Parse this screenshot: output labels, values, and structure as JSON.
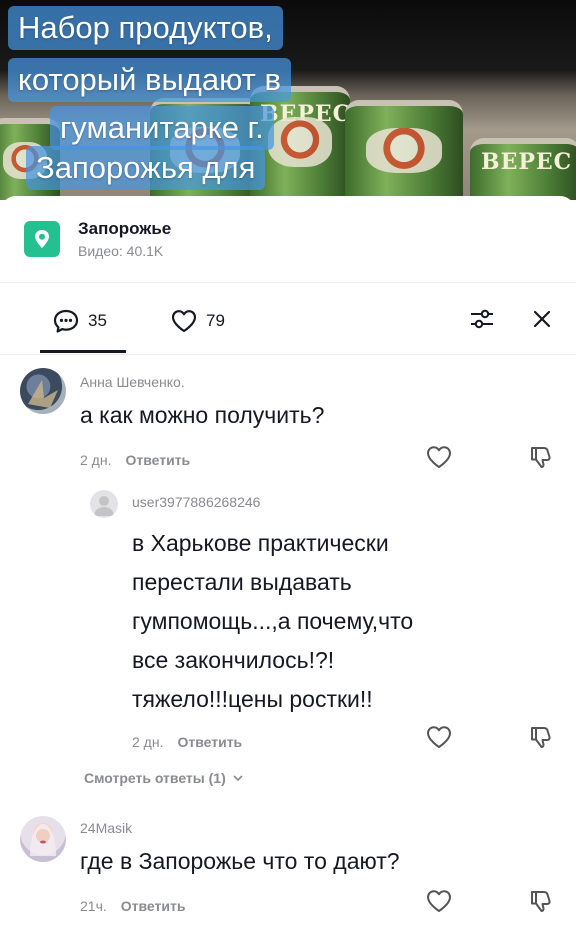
{
  "video": {
    "overlay_lines": [
      "Набор продуктов,",
      "который выдают в",
      "гуманитарке г.",
      "Запорожья для"
    ],
    "can_brand": "ВЕРЕС"
  },
  "location": {
    "name": "Запорожье",
    "views": "Видео: 40.1K",
    "icon": "location-pin-icon",
    "color": "#25c08f"
  },
  "stats": {
    "comments_count": "35",
    "likes_count": "79"
  },
  "comments": [
    {
      "author": "Анна Шевченко.",
      "text": "а как можно получить?",
      "time": "2 дн.",
      "reply_label": "Ответить"
    },
    {
      "author": "user3977886268246",
      "text_lines": [
        "в Харькове практически",
        "перестали выдавать",
        "гумпомощь...,а почему,что",
        "все закончилось!?!",
        "тяжело!!!цены ростки!!"
      ],
      "time": "2 дн.",
      "reply_label": "Ответить"
    },
    {
      "author": "24Masik",
      "text": "где в Запорожье что то дают?",
      "time": "21ч.",
      "reply_label": "Ответить"
    }
  ],
  "view_replies": "Смотреть ответы (1)"
}
